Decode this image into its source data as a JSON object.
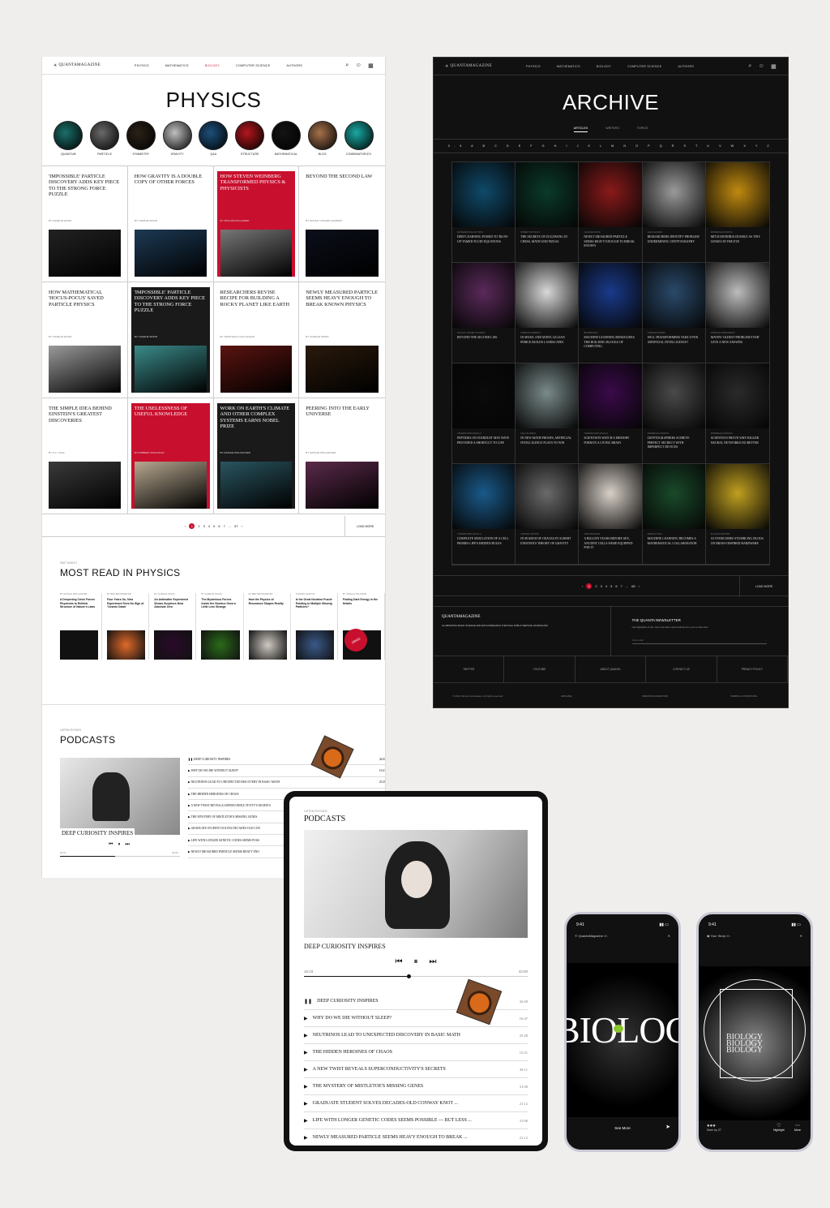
{
  "colors": {
    "accent": "#c8102e",
    "dark": "#111111"
  },
  "physics": {
    "logo": "QUANTAMAGAZINE",
    "nav": [
      "PHYSICS",
      "MATHEMATICS",
      "BIOLOGY",
      "COMPUTER SCIENCE",
      "AUTHORS"
    ],
    "active_nav": "BIOLOGY",
    "title": "PHYSICS",
    "topics": [
      {
        "label": "QUANTUM",
        "color": "#1b6f6a"
      },
      {
        "label": "PARTICLE",
        "color": "#6a6a6a"
      },
      {
        "label": "SYMMETRY",
        "color": "#2b2218"
      },
      {
        "label": "GRAVITY",
        "color": "#c0c0c0"
      },
      {
        "label": "Q&A",
        "color": "#1d4f7a"
      },
      {
        "label": "STRUCTURE",
        "color": "#b3161d"
      },
      {
        "label": "MATHEMATICAL",
        "color": "#141414"
      },
      {
        "label": "BLOG",
        "color": "#a5714c"
      },
      {
        "label": "COMBINATORICS",
        "color": "#1aa9a3"
      }
    ],
    "cards": [
      {
        "title": "'IMPOSSIBLE' PARTICLE DISCOVERY ADDS KEY PIECE TO THE STRONG FORCE PUZZLE",
        "by": "BY CHARLIE WOOD",
        "style": "",
        "img": "#222"
      },
      {
        "title": "HOW GRAVITY IS A DOUBLE COPY OF OTHER FORCES",
        "by": "BY CHARLIE WOOD",
        "style": "",
        "img": "#1d3a55"
      },
      {
        "title": "HOW STEVEN WEINBERG TRANSFORMED PHYSICS & PHYSICISTS",
        "by": "BY NIMA ARKANI-HAMED",
        "style": "red",
        "img": "#777"
      },
      {
        "title": "BEYOND THE SECOND LAW",
        "by": "BY NICOLE YUNGER HALPERN",
        "style": "",
        "img": "#0c0f1a"
      },
      {
        "title": "HOW MATHEMATICAL 'HOCUS-POCUS' SAVED PARTICLE PHYSICS",
        "by": "BY CHARLIE WOOD",
        "style": "",
        "img": "#9a9a9a"
      },
      {
        "title": "'IMPOSSIBLE' PARTICLE DISCOVERY ADDS KEY PIECE TO THE STRONG FORCE PUZZLE",
        "by": "BY CHARLIE WOOD",
        "style": "dark",
        "img": "#3b8a8a"
      },
      {
        "title": "RESEARCHERS REVISE RECIPE FOR BUILDING A ROCKY PLANET LIKE EARTH",
        "by": "BY JONATHAN O'CALLAGHAN",
        "style": "",
        "img": "#5a1410"
      },
      {
        "title": "NEWLY MEASURED PARTICLE SEEMS HEAVY ENOUGH TO BREAK KNOWN PHYSICS",
        "by": "BY CHARLIE WOOD",
        "style": "",
        "img": "#2a1a0c"
      },
      {
        "title": "THE SIMPLE IDEA BEHIND EINSTEIN'S GREATEST DISCOVERIES",
        "by": "BY K.C. COLE",
        "style": "",
        "img": "#3a3a3a"
      },
      {
        "title": "THE USELESSNESS OF USEFUL KNOWLEDGE",
        "by": "BY ROBBERT DIJKGRAAF",
        "style": "red",
        "img": "#b8a890"
      },
      {
        "title": "WORK ON EARTH'S CLIMATE AND OTHER COMPLEX SYSTEMS EARNS NOBEL PRIZE",
        "by": "BY NATALIE WOLCHOVER",
        "style": "dark",
        "img": "#2a5560"
      },
      {
        "title": "PEERING INTO THE EARLY UNIVERSE",
        "by": "BY NATALIE WOLCHOVER",
        "style": "",
        "img": "#5a2a4a"
      }
    ],
    "pager": {
      "pages": [
        "1",
        "2",
        "3",
        "4",
        "5",
        "6",
        "7",
        "...",
        "57"
      ],
      "load_more": "LOAD MORE"
    },
    "mostread": {
      "kicker": "PAST MONTH",
      "title": "MOST READ IN PHYSICS",
      "items": [
        {
          "by": "BY NATALIE WOLCHOVER",
          "title": "A Deepening Crisis Forces Physicists to Rethink Structure of Nature's Laws",
          "img": "#111"
        },
        {
          "by": "BY BEN BROOKMEYER",
          "title": "Four Years On, New Experiment Sees No Sign of 'Cosmic Dawn'",
          "img": "#e06a2a"
        },
        {
          "by": "BY CHARLIE WOOD",
          "title": "An Antimatter Experiment Shows Surprises Near Absolute Zero",
          "img": "#2a0a2a"
        },
        {
          "by": "BY CHARLIE WOOD",
          "title": "The Mysterious Forces Inside the Nucleus Grow a Little Less Strange",
          "img": "#2a6a1a"
        },
        {
          "by": "BY BEN BROOKMEYER",
          "title": "How the Physics of Resonance Shapes Reality",
          "img": "#cfc9c2"
        },
        {
          "by": "THOMAS LEWTON",
          "title": "Is the Great Neutrino Puzzle Pointing to Multiple Missing Particles?",
          "img": "#3a5a8a"
        },
        {
          "by": "BY JOSHUA SOLOMON",
          "title": "Finding Dark Energy in the Details",
          "img": "#111"
        }
      ],
      "drag": "DRAG"
    },
    "podcasts": {
      "kicker": "LISTEN PHYSICS",
      "title": "PODCASTS",
      "now": "DEEP CURIOSITY INSPIRES",
      "t0": "16:11",
      "t1": "42:00",
      "items": [
        {
          "title": "DEEP CURIOSITY INSPIRES",
          "time": "42:00"
        },
        {
          "title": "WHY DO WE DIE WITHOUT SLEEP?",
          "time": "16:47"
        },
        {
          "title": "NEUTRINOS LEAD TO UNEXPECTED DISCOVERY IN BASIC MATH",
          "time": "25:28"
        },
        {
          "title": "THE HIDDEN HEROINES OF CHAOS",
          "time": ""
        },
        {
          "title": "A NEW TWIST REVEALS SUPERCONDUCTIVITY'S SECRETS",
          "time": ""
        },
        {
          "title": "THE MYSTERY OF MISTLETOE'S MISSING GENES",
          "time": ""
        },
        {
          "title": "GRADUATE STUDENT SOLVES DECADES-OLD CON",
          "time": ""
        },
        {
          "title": "LIFE WITH LONGER GENETIC CODES SEEMS POSS",
          "time": ""
        },
        {
          "title": "NEWLY MEASURED PARTICLE SEEMS HEAVY ENO",
          "time": ""
        }
      ]
    }
  },
  "archive": {
    "title": "ARCHIVE",
    "tabs": [
      "ARTICLES",
      "WRITERS",
      "TOPICS"
    ],
    "alpha": "0-9 A B C D E F G H I J K L M N O P Q R S T U V W X Y Z",
    "items": [
      {
        "by": "MATHEMATICAL PHYSICS",
        "title": "DEEP LEARNING POISED TO 'BLOW UP' FAMED FLUID EQUATIONS",
        "img": "#0f4a6a"
      },
      {
        "by": "ROBERT MUTSUYA",
        "title": "THE SECRETS OF ZUGZWANG IN CHESS, MATH AND PIZZAS",
        "img": "#0a3a2a"
      },
      {
        "by": "CHARLIE WOOD",
        "title": "NEWLY MEASURED PARTICLE SEEMS HEAVY ENOUGH TO BREAK KNOWN",
        "img": "#8a1a1a"
      },
      {
        "by": "LEILA SLOMAN",
        "title": "RESEARCHERS IDENTIFY PROBLEM UNDERMINING CRYPTOGRAPHY",
        "img": "#9a9a9a"
      },
      {
        "by": "MORDECHAI RORVIG",
        "title": "MITOCHONDRIA DOUBLE AS TINY LENSES IN THE EYE",
        "img": "#c08a10"
      },
      {
        "by": "NICOLE YUNGER HALPERN",
        "title": "BEYOND THE SECOND LAW",
        "img": "#5a2a5a"
      },
      {
        "by": "SIOBHAN ROBERTS",
        "title": "IN MUSIC AND MATH, LILLIAN PIERCE BUILDS LANDSCAPES",
        "img": "#d8d8d8"
      },
      {
        "by": "BEN BROOKS",
        "title": "MACHINE LEARNING REIMAGINES THE BUILDING BLOCKS OF COMPUTING",
        "img": "#1a3a8a"
      },
      {
        "by": "STEPHEN ORNES",
        "title": "WILL TRANSFORMERS TAKE OVER ARTIFICIAL INTELLIGENCE?",
        "img": "#2a4a6a"
      },
      {
        "by": "JORDANA CEPELEWICZ",
        "title": "MATH'S 'OLDEST PROBLEM EVER' GETS A NEW ANSWER",
        "img": "#bcbcbc"
      },
      {
        "by": "YASEMIN SAPLAKOGLU",
        "title": "PEPTIDES ON STARDUST MAY HAVE PROVIDED A SHORTCUT TO LIFE",
        "img": "#0a0a0a"
      },
      {
        "by": "LEILA SLOMAN",
        "title": "IN NEW MATH PROOFS, ARTIFICIAL INTELLIGENCE PLAYS TO WIN",
        "img": "#7a8a8a"
      },
      {
        "by": "YASEMIN SAPLAKOGLU",
        "title": "SCIENTISTS WATCH A MEMORY FORM IN A LIVING BRAIN",
        "img": "#3a0a4a"
      },
      {
        "by": "MORDECHAI RORVIG",
        "title": "CRYPTOGRAPHERS ACHIEVE PERFECT SECRECY WITH IMPERFECT DEVICES",
        "img": "#4a4a4a"
      },
      {
        "by": "MORDECHAI RORVIG",
        "title": "SCIENTISTS PROVE WHY BIGGER NEURAL NETWORKS DO BETTER",
        "img": "#2a2a2a"
      },
      {
        "by": "YASEMIN SAPLAKOGLU",
        "title": "COMPLETE SIMULATION OF A CELL PROBES LIFE'S HIDDEN RULES",
        "img": "#1a5a8a"
      },
      {
        "by": "THOMAS LEWTON",
        "title": "IN SEARCH OF CRACKS IN ALBERT EINSTEIN'S THEORY OF GRAVITY",
        "img": "#6a6a6a"
      },
      {
        "by": "JAKE BUEHLER",
        "title": "A BILLION YEARS BEFORE SEX, ANCIENT CELLS WERE EQUIPPED FOR IT",
        "img": "#d8d0c8"
      },
      {
        "by": "MARCUS WOO",
        "title": "MACHINE LEARNING BECOMES A MATHEMATICAL COLLABORATOR",
        "img": "#1a4a2a"
      },
      {
        "by": "ALLISON WHITTEN",
        "title": "AI OVERCOMES STUMBLING BLOCK ON BRAIN-INSPIRED HARDWARE",
        "img": "#c0a020"
      }
    ],
    "pager": {
      "pages": [
        "1",
        "2",
        "3",
        "4",
        "5",
        "6",
        "7",
        "...",
        "68"
      ],
      "load_more": "LOAD MORE"
    },
    "footer": {
      "logo": "QUANTAMAGAZINE",
      "about": "ILLUMINATING BASIC SCIENCE AND MATH RESEARCH THROUGH PUBLIC SERVICE JOURNALISM",
      "newsletter": "THE QUANTA NEWSLETTER",
      "newsletter_sub": "Get highlights of the most important news delivered to your email inbox",
      "email_placeholder": "Your email",
      "links": [
        "TWITTER",
        "YOUTUBE",
        "ABOUT QUANTA",
        "CONTACT US",
        "PRIVACY POLICY"
      ],
      "bottom": [
        "© 2021 Simons Foundation. All rights reserved.",
        "ARCHIVE",
        "SIMONS FOUNDATION",
        "TERMS & CONDITIONS"
      ]
    }
  },
  "tablet": {
    "kicker": "LISTEN PHYSICS",
    "title": "PODCASTS",
    "now": "DEEP CURIOSITY INSPIRES",
    "t0": "16:33",
    "t1": "42:00",
    "items": [
      {
        "title": "DEEP CURIOSITY INSPIRES",
        "time": "42:00"
      },
      {
        "title": "WHY DO WE DIE WITHOUT SLEEP?",
        "time": "16:47"
      },
      {
        "title": "NEUTRINOS LEAD TO UNEXPECTED DISCOVERY IN BASIC MATH",
        "time": "25:28"
      },
      {
        "title": "THE HIDDEN HEROINES OF CHAOS",
        "time": "15:21"
      },
      {
        "title": "A NEW TWIST REVEALS SUPERCONDUCTIVITY'S SECRETS",
        "time": "30:11"
      },
      {
        "title": "THE MYSTERY OF MISTLETOE'S MISSING GENES",
        "time": "31:00"
      },
      {
        "title": "GRADUATE STUDENT SOLVES DECADES-OLD CONWAY KNOT ...",
        "time": "21:12"
      },
      {
        "title": "LIFE WITH LONGER GENETIC CODES SEEMS POSSIBLE — BUT LESS ...",
        "time": "31:00"
      },
      {
        "title": "NEWLY MEASURED PARTICLE SEEMS HEAVY ENOUGH TO BREAK ...",
        "time": "21:12"
      }
    ]
  },
  "phone1": {
    "time": "9:41",
    "account": "QuantaMagazine",
    "ago": "6h",
    "word": "BIOLOG",
    "cta": "See More"
  },
  "phone2": {
    "time": "9:41",
    "account": "Your Story",
    "ago": "6h",
    "word": "BIOLOGY",
    "seen": "Seen by 27",
    "highlight": "Highlight",
    "more": "More"
  }
}
